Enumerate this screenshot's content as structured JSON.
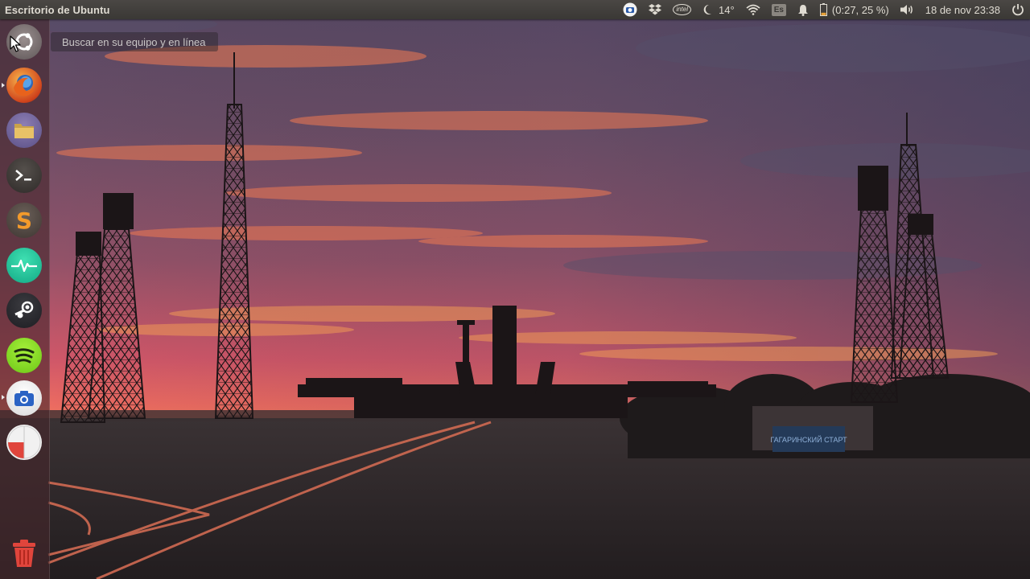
{
  "panel": {
    "title": "Escritorio de Ubuntu",
    "indicators": [
      {
        "name": "camera-indicator-icon"
      },
      {
        "name": "dropbox-icon"
      },
      {
        "name": "intel-icon",
        "text": "intel"
      },
      {
        "name": "weather-moon-icon",
        "text": "14°"
      },
      {
        "name": "wifi-icon"
      },
      {
        "name": "keyboard-layout",
        "text": "Es"
      },
      {
        "name": "notification-bell-icon"
      },
      {
        "name": "battery-icon",
        "text": "(0:27, 25 %)",
        "level": 0.25
      },
      {
        "name": "volume-icon"
      },
      {
        "name": "clock",
        "text": "18 de nov 23:38"
      },
      {
        "name": "session-power-icon"
      }
    ]
  },
  "search": {
    "placeholder": "Buscar en su equipo y en línea"
  },
  "launcher": {
    "items": [
      {
        "name": "ubuntu-dash-icon",
        "running": false
      },
      {
        "name": "firefox-icon",
        "running": true
      },
      {
        "name": "files-icon",
        "running": false
      },
      {
        "name": "terminal-icon",
        "running": false
      },
      {
        "name": "sublime-text-icon",
        "running": false,
        "letter": "S"
      },
      {
        "name": "system-monitor-icon",
        "running": false
      },
      {
        "name": "steam-icon",
        "running": false
      },
      {
        "name": "spotify-icon",
        "running": false
      },
      {
        "name": "screenshot-camera-icon",
        "running": true
      },
      {
        "name": "disk-usage-icon",
        "running": false
      },
      {
        "name": "trash-icon",
        "running": false
      }
    ]
  },
  "wallpaper": {
    "description_colors": [
      "#6a5d78",
      "#e8625a",
      "#f08a3c",
      "#3a3038"
    ],
    "sign_text": "ГАГАРИНСКИЙ СТАРТ"
  }
}
